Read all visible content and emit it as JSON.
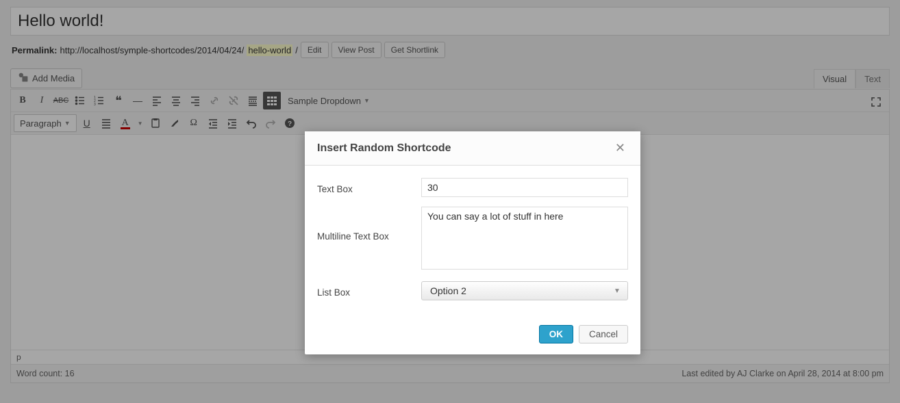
{
  "post": {
    "title": "Hello world!",
    "permalink_label": "Permalink:",
    "permalink_base": "http://localhost/symple-shortcodes/2014/04/24/",
    "permalink_slug": "hello-world",
    "permalink_trail": "/",
    "edit_label": "Edit",
    "view_label": "View Post",
    "shortlink_label": "Get Shortlink"
  },
  "media": {
    "add_media_label": "Add Media"
  },
  "tabs": {
    "visual": "Visual",
    "text": "Text"
  },
  "toolbar": {
    "sample_dropdown": "Sample Dropdown",
    "format_select": "Paragraph"
  },
  "status": {
    "path": "p"
  },
  "footer": {
    "word_count": "Word count: 16",
    "last_edited": "Last edited by AJ Clarke on April 28, 2014 at 8:00 pm"
  },
  "modal": {
    "title": "Insert Random Shortcode",
    "fields": {
      "textbox_label": "Text Box",
      "textbox_value": "30",
      "multiline_label": "Multiline Text Box",
      "multiline_value": "You can say a lot of stuff in here",
      "listbox_label": "List Box",
      "listbox_value": "Option 2"
    },
    "ok_label": "OK",
    "cancel_label": "Cancel"
  }
}
